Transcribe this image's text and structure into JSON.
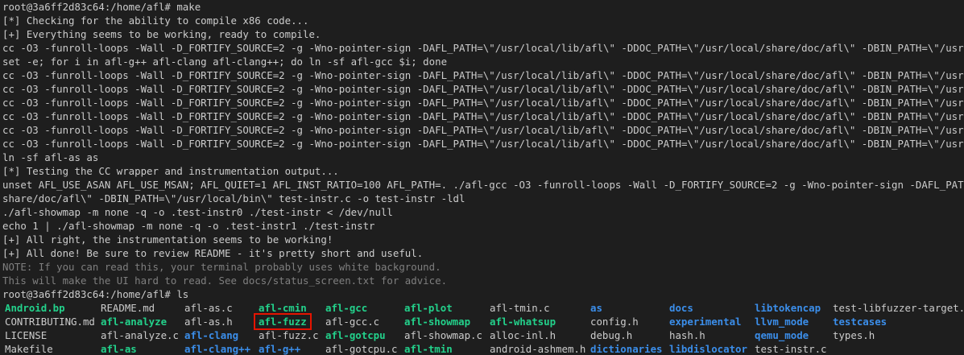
{
  "terminal": {
    "lines": [
      {
        "text": "root@3a6ff2d83c64:/home/afl# make",
        "style": "normal"
      },
      {
        "text": "[*] Checking for the ability to compile x86 code...",
        "style": "normal"
      },
      {
        "text": "[+] Everything seems to be working, ready to compile.",
        "style": "normal"
      },
      {
        "text": "cc -O3 -funroll-loops -Wall -D_FORTIFY_SOURCE=2 -g -Wno-pointer-sign -DAFL_PATH=\\\"/usr/local/lib/afl\\\" -DDOC_PATH=\\\"/usr/local/share/doc/afl\\\" -DBIN_PATH=\\\"/usr/local/bin\\",
        "style": "normal"
      },
      {
        "text": "set -e; for i in afl-g++ afl-clang afl-clang++; do ln -sf afl-gcc $i; done",
        "style": "normal"
      },
      {
        "text": "cc -O3 -funroll-loops -Wall -D_FORTIFY_SOURCE=2 -g -Wno-pointer-sign -DAFL_PATH=\\\"/usr/local/lib/afl\\\" -DDOC_PATH=\\\"/usr/local/share/doc/afl\\\" -DBIN_PATH=\\\"/usr/local/bin\\",
        "style": "normal"
      },
      {
        "text": "cc -O3 -funroll-loops -Wall -D_FORTIFY_SOURCE=2 -g -Wno-pointer-sign -DAFL_PATH=\\\"/usr/local/lib/afl\\\" -DDOC_PATH=\\\"/usr/local/share/doc/afl\\\" -DBIN_PATH=\\\"/usr/local/bin\\",
        "style": "normal"
      },
      {
        "text": "cc -O3 -funroll-loops -Wall -D_FORTIFY_SOURCE=2 -g -Wno-pointer-sign -DAFL_PATH=\\\"/usr/local/lib/afl\\\" -DDOC_PATH=\\\"/usr/local/share/doc/afl\\\" -DBIN_PATH=\\\"/usr/local/bin\\",
        "style": "normal"
      },
      {
        "text": "cc -O3 -funroll-loops -Wall -D_FORTIFY_SOURCE=2 -g -Wno-pointer-sign -DAFL_PATH=\\\"/usr/local/lib/afl\\\" -DDOC_PATH=\\\"/usr/local/share/doc/afl\\\" -DBIN_PATH=\\\"/usr/local/bin\\",
        "style": "normal"
      },
      {
        "text": "cc -O3 -funroll-loops -Wall -D_FORTIFY_SOURCE=2 -g -Wno-pointer-sign -DAFL_PATH=\\\"/usr/local/lib/afl\\\" -DDOC_PATH=\\\"/usr/local/share/doc/afl\\\" -DBIN_PATH=\\\"/usr/local/bin\\",
        "style": "normal"
      },
      {
        "text": "cc -O3 -funroll-loops -Wall -D_FORTIFY_SOURCE=2 -g -Wno-pointer-sign -DAFL_PATH=\\\"/usr/local/lib/afl\\\" -DDOC_PATH=\\\"/usr/local/share/doc/afl\\\" -DBIN_PATH=\\\"/usr/local/bin\\",
        "style": "normal"
      },
      {
        "text": "ln -sf afl-as as",
        "style": "normal"
      },
      {
        "text": "[*] Testing the CC wrapper and instrumentation output...",
        "style": "normal"
      },
      {
        "text": "unset AFL_USE_ASAN AFL_USE_MSAN; AFL_QUIET=1 AFL_INST_RATIO=100 AFL_PATH=. ./afl-gcc -O3 -funroll-loops -Wall -D_FORTIFY_SOURCE=2 -g -Wno-pointer-sign -DAFL_PATH=\\\"/usr/lo",
        "style": "normal"
      },
      {
        "text": "share/doc/afl\\\" -DBIN_PATH=\\\"/usr/local/bin\\\" test-instr.c -o test-instr -ldl",
        "style": "normal"
      },
      {
        "text": "./afl-showmap -m none -q -o .test-instr0 ./test-instr < /dev/null",
        "style": "normal"
      },
      {
        "text": "echo 1 | ./afl-showmap -m none -q -o .test-instr1 ./test-instr",
        "style": "normal"
      },
      {
        "text": "[+] All right, the instrumentation seems to be working!",
        "style": "normal"
      },
      {
        "text": "[+] All done! Be sure to review README - it's pretty short and useful.",
        "style": "normal"
      },
      {
        "text": "NOTE: If you can read this, your terminal probably uses white background.",
        "style": "dim"
      },
      {
        "text": "This will make the UI hard to read. See docs/status_screen.txt for advice.",
        "style": "dim"
      },
      {
        "text": "root@3a6ff2d83c64:/home/afl# ls",
        "style": "normal"
      }
    ],
    "ls_rows": [
      [
        {
          "text": "Android.bp",
          "kind": "exec"
        },
        {
          "text": "README.md",
          "kind": "file"
        },
        {
          "text": "afl-as.c",
          "kind": "file"
        },
        {
          "text": "afl-cmin",
          "kind": "exec"
        },
        {
          "text": "afl-gcc",
          "kind": "exec"
        },
        {
          "text": "afl-plot",
          "kind": "exec"
        },
        {
          "text": "afl-tmin.c",
          "kind": "file"
        },
        {
          "text": "as",
          "kind": "dir"
        },
        {
          "text": "docs",
          "kind": "dir"
        },
        {
          "text": "libtokencap",
          "kind": "dir"
        },
        {
          "text": "test-libfuzzer-target.c",
          "kind": "file"
        }
      ],
      [
        {
          "text": "CONTRIBUTING.md",
          "kind": "file"
        },
        {
          "text": "afl-analyze",
          "kind": "exec"
        },
        {
          "text": "afl-as.h",
          "kind": "file"
        },
        {
          "text": "afl-fuzz",
          "kind": "exec",
          "highlight": true
        },
        {
          "text": "afl-gcc.c",
          "kind": "file"
        },
        {
          "text": "afl-showmap",
          "kind": "exec"
        },
        {
          "text": "afl-whatsup",
          "kind": "exec"
        },
        {
          "text": "config.h",
          "kind": "file"
        },
        {
          "text": "experimental",
          "kind": "dir"
        },
        {
          "text": "llvm_mode",
          "kind": "dir"
        },
        {
          "text": "testcases",
          "kind": "dir"
        }
      ],
      [
        {
          "text": "LICENSE",
          "kind": "file"
        },
        {
          "text": "afl-analyze.c",
          "kind": "file"
        },
        {
          "text": "afl-clang",
          "kind": "dir"
        },
        {
          "text": "afl-fuzz.c",
          "kind": "file"
        },
        {
          "text": "afl-gotcpu",
          "kind": "exec"
        },
        {
          "text": "afl-showmap.c",
          "kind": "file"
        },
        {
          "text": "alloc-inl.h",
          "kind": "file"
        },
        {
          "text": "debug.h",
          "kind": "file"
        },
        {
          "text": "hash.h",
          "kind": "file"
        },
        {
          "text": "qemu_mode",
          "kind": "dir"
        },
        {
          "text": "types.h",
          "kind": "file"
        }
      ],
      [
        {
          "text": "Makefile",
          "kind": "file"
        },
        {
          "text": "afl-as",
          "kind": "exec"
        },
        {
          "text": "afl-clang++",
          "kind": "dir"
        },
        {
          "text": "afl-g++",
          "kind": "dir"
        },
        {
          "text": "afl-gotcpu.c",
          "kind": "file"
        },
        {
          "text": "afl-tmin",
          "kind": "exec"
        },
        {
          "text": "android-ashmem.h",
          "kind": "file"
        },
        {
          "text": "dictionaries",
          "kind": "dir"
        },
        {
          "text": "libdislocator",
          "kind": "dir"
        },
        {
          "text": "test-instr.c",
          "kind": "file"
        },
        {
          "text": "",
          "kind": "file"
        }
      ]
    ]
  },
  "colors": {
    "background": "#1e1e1e",
    "text": "#cccccc",
    "dim": "#7f7f7f",
    "exec": "#23d18b",
    "dir": "#3b8eea",
    "highlight_border": "#e51400"
  }
}
